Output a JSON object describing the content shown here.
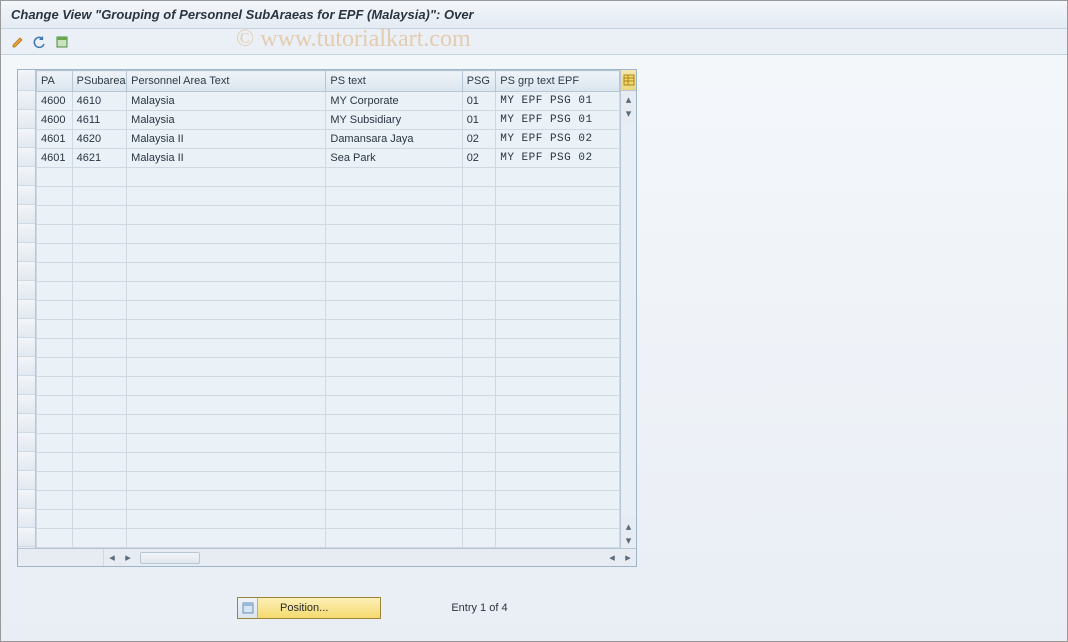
{
  "window": {
    "title": "Change View \"Grouping of Personnel SubAraeas for EPF (Malaysia)\": Over"
  },
  "watermark": "© www.tutorialkart.com",
  "toolbar": {
    "icons": [
      "edit-icon",
      "undo-icon",
      "select-all-icon"
    ]
  },
  "table": {
    "columns": [
      {
        "key": "pa",
        "label": "PA",
        "width": 34
      },
      {
        "key": "psub",
        "label": "PSubarea",
        "width": 52
      },
      {
        "key": "patext",
        "label": "Personnel Area Text",
        "width": 190
      },
      {
        "key": "pstext",
        "label": "PS text",
        "width": 130
      },
      {
        "key": "psg",
        "label": "PSG",
        "width": 32
      },
      {
        "key": "psgtext",
        "label": "PS grp text EPF",
        "width": 118
      }
    ],
    "rows": [
      {
        "pa": "4600",
        "psub": "4610",
        "patext": "Malaysia",
        "pstext": "MY Corporate",
        "psg": "01",
        "psgtext": "MY EPF PSG 01"
      },
      {
        "pa": "4600",
        "psub": "4611",
        "patext": "Malaysia",
        "pstext": "MY Subsidiary",
        "psg": "01",
        "psgtext": "MY EPF PSG 01"
      },
      {
        "pa": "4601",
        "psub": "4620",
        "patext": "Malaysia II",
        "pstext": "Damansara Jaya",
        "psg": "02",
        "psgtext": "MY EPF PSG 02"
      },
      {
        "pa": "4601",
        "psub": "4621",
        "patext": "Malaysia II",
        "pstext": "Sea Park",
        "psg": "02",
        "psgtext": "MY EPF PSG 02"
      }
    ],
    "total_visible_rows": 24
  },
  "footer": {
    "position_label": "Position...",
    "entry_text": "Entry 1 of 4"
  }
}
